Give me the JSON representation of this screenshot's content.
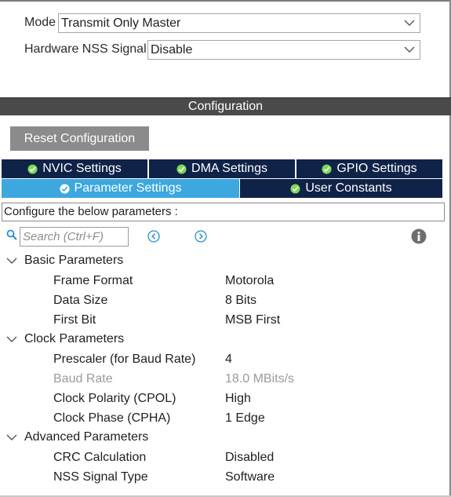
{
  "mode": {
    "label": "Mode",
    "value": "Transmit Only Master"
  },
  "nss": {
    "label": "Hardware NSS Signal",
    "value": "Disable"
  },
  "config_bar": {
    "title": "Configuration"
  },
  "reset_button": {
    "label": "Reset Configuration"
  },
  "tabs_row1": [
    {
      "label": "NVIC Settings",
      "active": false
    },
    {
      "label": "DMA Settings",
      "active": false
    },
    {
      "label": "GPIO Settings",
      "active": false
    }
  ],
  "tabs_row2": [
    {
      "label": "Parameter Settings",
      "active": true
    },
    {
      "label": "User Constants",
      "active": false
    }
  ],
  "info_text": "Configure the below parameters :",
  "search": {
    "placeholder": "Search (Ctrl+F)"
  },
  "groups": [
    {
      "title": "Basic Parameters",
      "params": [
        {
          "name": "Frame Format",
          "value": "Motorola",
          "disabled": false
        },
        {
          "name": "Data Size",
          "value": "8 Bits",
          "disabled": false
        },
        {
          "name": "First Bit",
          "value": "MSB First",
          "disabled": false
        }
      ]
    },
    {
      "title": "Clock Parameters",
      "params": [
        {
          "name": "Prescaler (for Baud Rate)",
          "value": "4",
          "disabled": false
        },
        {
          "name": "Baud Rate",
          "value": "18.0 MBits/s",
          "disabled": true
        },
        {
          "name": "Clock Polarity (CPOL)",
          "value": "High",
          "disabled": false
        },
        {
          "name": "Clock Phase (CPHA)",
          "value": "1 Edge",
          "disabled": false
        }
      ]
    },
    {
      "title": "Advanced Parameters",
      "params": [
        {
          "name": "CRC Calculation",
          "value": "Disabled",
          "disabled": false
        },
        {
          "name": "NSS Signal Type",
          "value": "Software",
          "disabled": false
        }
      ]
    }
  ],
  "colors": {
    "tab_dark": "#0f2248",
    "tab_active": "#3ca8df",
    "config_bar": "#4a4a4a",
    "reset_button": "#8b8b8b",
    "accent_blue": "#1e90d6",
    "disabled_text": "#9a9a9a"
  }
}
